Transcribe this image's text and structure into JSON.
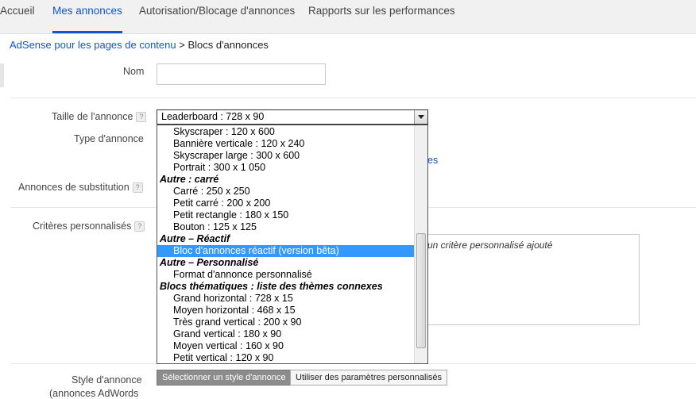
{
  "nav": {
    "tabs": [
      {
        "label": "Accueil"
      },
      {
        "label": "Mes annonces"
      },
      {
        "label": "Autorisation/Blocage d'annonces"
      },
      {
        "label": "Rapports sur les performances"
      }
    ]
  },
  "breadcrumb": {
    "link": "AdSense pour les pages de contenu",
    "sep": " > ",
    "current": "Blocs d'annonces"
  },
  "form": {
    "name_label": "Nom",
    "name_value": "",
    "size_label": "Taille de l'annonce",
    "type_label": "Type d'annonce",
    "backup_label": "Annonces de substitution",
    "criteria_label": "Critères personnalisés",
    "style_label": "Style d'annonce",
    "style_label2": "(annonces AdWords",
    "help_glyph": "?",
    "partial_link": "es",
    "criteria_text": "un critère personnalisé ajouté",
    "style_btn_select": "Sélectionner un style d'annonce",
    "style_btn_custom": "Utiliser des paramètres personnalisés"
  },
  "select": {
    "value": "Leaderboard : 728 x 90",
    "options": [
      {
        "label": "Skyscraper : 120 x 600",
        "group": false
      },
      {
        "label": "Bannière verticale : 120 x 240",
        "group": false
      },
      {
        "label": "Skyscraper large : 300 x 600",
        "group": false
      },
      {
        "label": "Portrait : 300 x 1 050",
        "group": false
      },
      {
        "label": "Autre : carré",
        "group": true
      },
      {
        "label": "Carré : 250 x 250",
        "group": false
      },
      {
        "label": "Petit carré : 200 x 200",
        "group": false
      },
      {
        "label": "Petit rectangle : 180 x 150",
        "group": false
      },
      {
        "label": "Bouton : 125 x 125",
        "group": false
      },
      {
        "label": "Autre – Réactif",
        "group": true
      },
      {
        "label": "Bloc d'annonces réactif (version bêta)",
        "group": false,
        "selected": true
      },
      {
        "label": "Autre – Personnalisé",
        "group": true
      },
      {
        "label": "Format d'annonce personnalisé",
        "group": false
      },
      {
        "label": "Blocs thématiques : liste des thèmes connexes",
        "group": true
      },
      {
        "label": "Grand horizontal : 728 x 15",
        "group": false
      },
      {
        "label": "Moyen horizontal : 468 x 15",
        "group": false
      },
      {
        "label": "Très grand vertical : 200 x 90",
        "group": false
      },
      {
        "label": "Grand vertical : 180 x 90",
        "group": false
      },
      {
        "label": "Moyen vertical : 160 x 90",
        "group": false
      },
      {
        "label": "Petit vertical : 120 x 90",
        "group": false
      }
    ]
  },
  "colors": {
    "accent": "#1155cc",
    "selection": "#3399ff"
  }
}
